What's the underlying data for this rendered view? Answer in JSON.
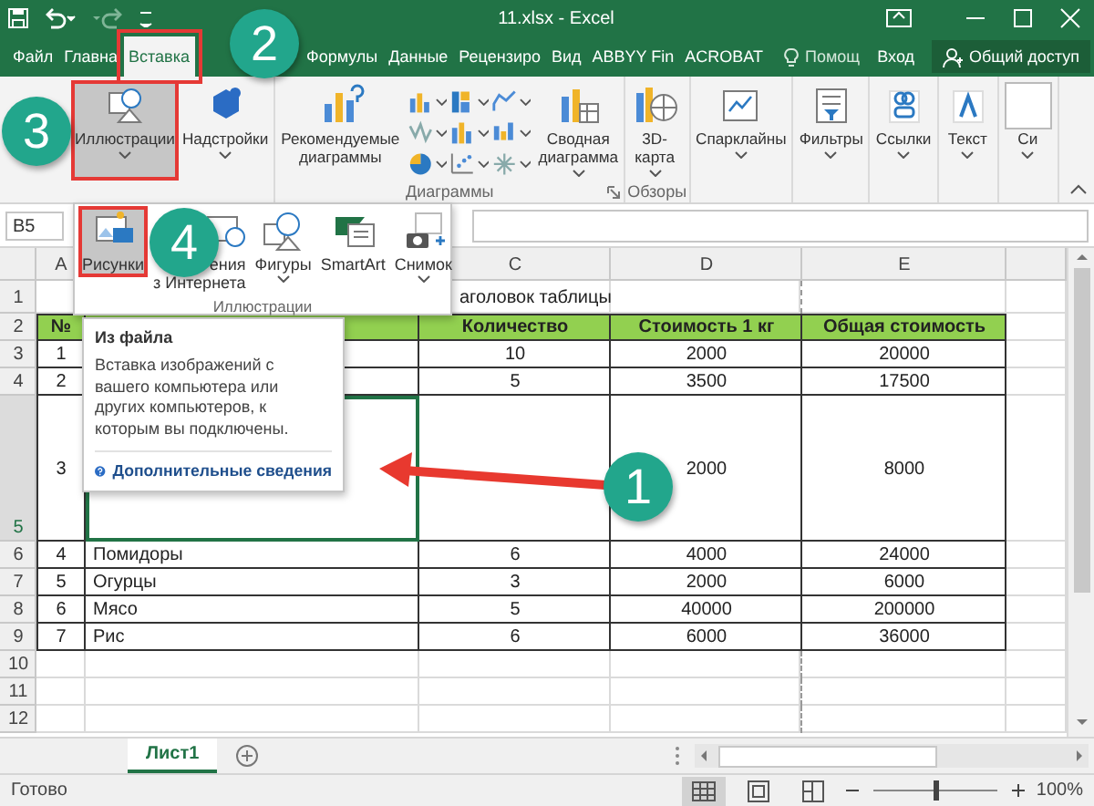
{
  "window": {
    "title": "11.xlsx - Excel"
  },
  "tabs": [
    {
      "label": "Файл",
      "selected": false,
      "highlighted": false
    },
    {
      "label": "Главна",
      "selected": false,
      "highlighted": false
    },
    {
      "label": "Вставка",
      "selected": true,
      "highlighted": true
    },
    {
      "label": "Формулы",
      "selected": false,
      "highlighted": false
    },
    {
      "label": "Данные",
      "selected": false,
      "highlighted": false
    },
    {
      "label": "Рецензиро",
      "selected": false,
      "highlighted": false
    },
    {
      "label": "Вид",
      "selected": false,
      "highlighted": false
    },
    {
      "label": "ABBYY Fin",
      "selected": false,
      "highlighted": false
    },
    {
      "label": "ACROBAT",
      "selected": false,
      "highlighted": false
    }
  ],
  "tell_me": "Помощ",
  "sign_in": "Вход",
  "share": "Общий доступ",
  "ribbon": {
    "groups": [
      {
        "buttons": [
          {
            "kind": "large",
            "lines": [
              "Иллюстрации"
            ],
            "dropdown": true,
            "selected": true,
            "highlighted": true
          },
          {
            "kind": "large",
            "lines": [
              "Надстройки"
            ],
            "dropdown": true,
            "selected": false,
            "highlighted": false
          }
        ]
      },
      {
        "label": "Диаграммы",
        "launcher": true,
        "buttons": [
          {
            "kind": "large",
            "lines": [
              "Рекомендуемые",
              "диаграммы"
            ],
            "dropdown": false,
            "selected": false,
            "highlighted": false
          },
          {
            "kind": "gallery"
          },
          {
            "kind": "large",
            "lines": [
              "Сводная",
              "диаграмма"
            ],
            "dropdown": true,
            "selected": false,
            "highlighted": false
          }
        ]
      },
      {
        "label": "Обзоры",
        "buttons": [
          {
            "kind": "large",
            "lines": [
              "3D-",
              "карта"
            ],
            "dropdown": true,
            "selected": false,
            "highlighted": false
          }
        ]
      },
      {
        "buttons": [
          {
            "kind": "large",
            "lines": [
              "Спарклайны"
            ],
            "dropdown": true,
            "selected": false,
            "highlighted": false
          }
        ]
      },
      {
        "buttons": [
          {
            "kind": "large",
            "lines": [
              "Фильтры"
            ],
            "dropdown": true,
            "selected": false,
            "highlighted": false
          }
        ]
      },
      {
        "buttons": [
          {
            "kind": "large",
            "lines": [
              "Ссылки"
            ],
            "dropdown": true,
            "selected": false,
            "highlighted": false
          }
        ]
      },
      {
        "buttons": [
          {
            "kind": "large",
            "lines": [
              "Текст"
            ],
            "dropdown": true,
            "selected": false,
            "highlighted": false
          }
        ]
      },
      {
        "buttons": [
          {
            "kind": "large",
            "lines": [
              "Си"
            ],
            "dropdown": true,
            "selected": false,
            "highlighted": false
          }
        ]
      }
    ]
  },
  "illustrations_menu": {
    "items": [
      {
        "lines": [
          "Рисунки"
        ],
        "dropdown": false,
        "selected": true,
        "highlighted": true
      },
      {
        "lines": [
          "ения",
          "з Интернета"
        ],
        "dropdown": false,
        "selected": false,
        "highlighted": false
      },
      {
        "lines": [
          "Фигуры"
        ],
        "dropdown": true,
        "selected": false,
        "highlighted": false
      },
      {
        "lines": [
          "SmartArt"
        ],
        "dropdown": false,
        "selected": false,
        "highlighted": false
      },
      {
        "lines": [
          "Снимок"
        ],
        "dropdown": true,
        "selected": false,
        "highlighted": false
      }
    ],
    "label": "Иллюстрации"
  },
  "formula_bar": {
    "name_box": "B5"
  },
  "sheet": {
    "column_headers": {
      "A": "A",
      "C": "C",
      "D": "D",
      "E": "E"
    },
    "rows": [
      {
        "number": "1",
        "kind": "title",
        "selected": false,
        "cells": {
          "C": "аголовок таблицы"
        }
      },
      {
        "number": "2",
        "kind": "header",
        "selected": false,
        "cells": {
          "A": "№",
          "C": "Количество",
          "D": "Стоимость 1 кг",
          "E": "Общая стоимость"
        }
      },
      {
        "number": "3",
        "kind": "data",
        "selected": false,
        "cells": {
          "A": "1",
          "C": "10",
          "D": "2000",
          "E": "20000"
        }
      },
      {
        "number": "4",
        "kind": "data",
        "selected": false,
        "cells": {
          "A": "2",
          "C": "5",
          "D": "3500",
          "E": "17500"
        }
      },
      {
        "number": "5",
        "kind": "tall",
        "selected": true,
        "cells": {
          "A": "3",
          "D": "2000",
          "E": "8000"
        }
      },
      {
        "number": "6",
        "kind": "data",
        "selected": false,
        "cells": {
          "A": "4",
          "B": "Помидоры",
          "C": "6",
          "D": "4000",
          "E": "24000"
        }
      },
      {
        "number": "7",
        "kind": "data",
        "selected": false,
        "cells": {
          "A": "5",
          "B": "Огурцы",
          "C": "3",
          "D": "2000",
          "E": "6000"
        }
      },
      {
        "number": "8",
        "kind": "data",
        "selected": false,
        "cells": {
          "A": "6",
          "B": "Мясо",
          "C": "5",
          "D": "40000",
          "E": "200000"
        }
      },
      {
        "number": "9",
        "kind": "data",
        "selected": false,
        "cells": {
          "A": "7",
          "B": "Рис",
          "C": "6",
          "D": "6000",
          "E": "36000"
        }
      },
      {
        "number": "10",
        "kind": "empty",
        "selected": false
      },
      {
        "number": "11",
        "kind": "empty",
        "selected": false
      },
      {
        "number": "12",
        "kind": "empty",
        "selected": false
      }
    ]
  },
  "tooltip": {
    "title": "Из файла",
    "body": "Вставка изображений с вашего компьютера или других компьютеров, к которым вы подключены.",
    "link": "Дополнительные сведения"
  },
  "sheet_tabs": [
    {
      "label": "Лист1",
      "selected": true
    }
  ],
  "status_bar": {
    "status": "Готово",
    "views": [
      {
        "selected": true
      },
      {
        "selected": false
      },
      {
        "selected": false
      }
    ],
    "zoom": {
      "level": 0.5,
      "reading": "100%"
    }
  },
  "annotations": {
    "markers": [
      {
        "number": "1"
      },
      {
        "number": "2"
      },
      {
        "number": "3"
      },
      {
        "number": "4"
      }
    ]
  }
}
